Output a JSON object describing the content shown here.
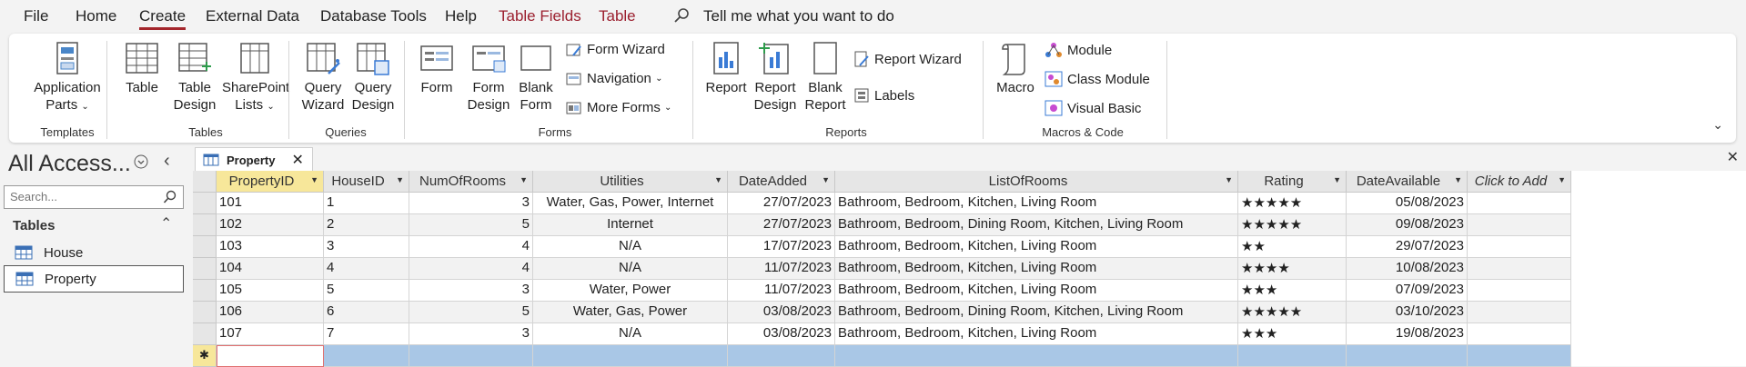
{
  "menu": {
    "file": "File",
    "home": "Home",
    "create": "Create",
    "external": "External Data",
    "dbtools": "Database Tools",
    "help": "Help",
    "table_fields": "Table Fields",
    "table": "Table",
    "tell": "Tell me what you want to do"
  },
  "ribbon": {
    "groups": {
      "templates": "Templates",
      "tables": "Tables",
      "queries": "Queries",
      "forms": "Forms",
      "reports": "Reports",
      "macros": "Macros & Code"
    },
    "app_parts_1": "Application",
    "app_parts_2": "Parts",
    "table": "Table",
    "table_design_1": "Table",
    "table_design_2": "Design",
    "sharepoint_1": "SharePoint",
    "sharepoint_2": "Lists",
    "query_wizard_1": "Query",
    "query_wizard_2": "Wizard",
    "query_design_1": "Query",
    "query_design_2": "Design",
    "form": "Form",
    "form_design_1": "Form",
    "form_design_2": "Design",
    "blank_form_1": "Blank",
    "blank_form_2": "Form",
    "form_wizard": "Form Wizard",
    "navigation": "Navigation",
    "more_forms": "More Forms",
    "report": "Report",
    "report_design_1": "Report",
    "report_design_2": "Design",
    "blank_report_1": "Blank",
    "blank_report_2": "Report",
    "report_wizard": "Report Wizard",
    "labels": "Labels",
    "macro": "Macro",
    "module": "Module",
    "class_module": "Class Module",
    "visual_basic": "Visual Basic"
  },
  "nav": {
    "title": "All Access...",
    "search_placeholder": "Search...",
    "section": "Tables",
    "items": [
      "House",
      "Property"
    ]
  },
  "tab": {
    "label": "Property"
  },
  "table": {
    "columns": [
      "PropertyID",
      "HouseID",
      "NumOfRooms",
      "Utilities",
      "DateAdded",
      "ListOfRooms",
      "Rating",
      "DateAvailable",
      "Click to Add"
    ],
    "rows": [
      [
        "101",
        "1",
        "3",
        "Water, Gas, Power, Internet",
        "27/07/2023",
        "Bathroom, Bedroom, Kitchen, Living Room",
        "★★★★★",
        "05/08/2023"
      ],
      [
        "102",
        "2",
        "5",
        "Internet",
        "27/07/2023",
        "Bathroom, Bedroom, Dining Room, Kitchen, Living Room",
        "★★★★★",
        "09/08/2023"
      ],
      [
        "103",
        "3",
        "4",
        "N/A",
        "17/07/2023",
        "Bathroom, Bedroom, Kitchen, Living Room",
        "★★",
        "29/07/2023"
      ],
      [
        "104",
        "4",
        "4",
        "N/A",
        "11/07/2023",
        "Bathroom, Bedroom, Kitchen, Living Room",
        "★★★★",
        "10/08/2023"
      ],
      [
        "105",
        "5",
        "3",
        "Water, Power",
        "11/07/2023",
        "Bathroom, Bedroom, Kitchen, Living Room",
        "★★★",
        "07/09/2023"
      ],
      [
        "106",
        "6",
        "5",
        "Water, Gas, Power",
        "03/08/2023",
        "Bathroom, Bedroom, Dining Room, Kitchen, Living Room",
        "★★★★★",
        "03/10/2023"
      ],
      [
        "107",
        "7",
        "3",
        "N/A",
        "03/08/2023",
        "Bathroom, Bedroom, Kitchen, Living Room",
        "★★★",
        "19/08/2023"
      ]
    ],
    "new_row_marker": "✱"
  },
  "colors": {
    "accent": "#a4262c",
    "context_tab": "#9b1f2e",
    "new_row": "#a9c7e6",
    "header_selected": "#f7e79a"
  }
}
